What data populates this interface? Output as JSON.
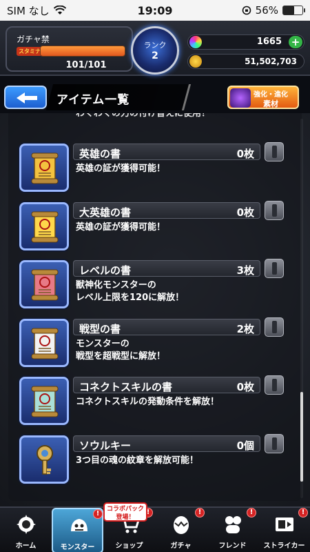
{
  "status_bar": {
    "carrier": "SIM なし",
    "time": "19:09",
    "battery_pct": "56%",
    "battery_level": 0.56
  },
  "header": {
    "gacha_label": "ガチャ禁",
    "stamina_label": "スタミナ",
    "stamina_text": "101/101",
    "stamina_fraction": 1.0,
    "rank_label": "ランク",
    "rank_value": "2",
    "orbs": "1665",
    "coins": "51,502,703"
  },
  "titlebar": {
    "title": "アイテム一覧",
    "evo_line1": "強化・進化",
    "evo_line2": "素材"
  },
  "partial_item": {
    "desc": "わくわくの力の付け替えに使用！"
  },
  "items": [
    {
      "name": "英雄の書",
      "count": "0枚",
      "desc": "英雄の証が獲得可能！",
      "icon": "scroll-red-icon",
      "color": "#f3c23f"
    },
    {
      "name": "大英雄の書",
      "count": "0枚",
      "desc": "英雄の証が獲得可能！",
      "icon": "scroll-gold-icon",
      "color": "#ffd84a"
    },
    {
      "name": "レベルの書",
      "count": "3枚",
      "desc": "獣神化モンスターの\nレベル上限を120に解放！",
      "icon": "scroll-pink-icon",
      "color": "#e77a86"
    },
    {
      "name": "戦型の書",
      "count": "2枚",
      "desc": "モンスターの\n戦型を超戦型に解放！",
      "icon": "scroll-white-icon",
      "color": "#f2f2f2"
    },
    {
      "name": "コネクトスキルの書",
      "count": "0枚",
      "desc": "コネクトスキルの発動条件を解放！",
      "icon": "scroll-teal-icon",
      "color": "#a9e0d8"
    },
    {
      "name": "ソウルキー",
      "count": "0個",
      "desc": "3つ目の魂の紋章を解放可能！",
      "icon": "soul-key-icon",
      "color": "#d8b25a"
    }
  ],
  "scroll": {
    "position": 0.72
  },
  "nav": {
    "collab_tag": "コラボパック\n登場！",
    "items": [
      {
        "label": "ホーム",
        "icon": "home-icon"
      },
      {
        "label": "モンスター",
        "icon": "monster-icon"
      },
      {
        "label": "ショップ",
        "icon": "shop-cart-icon"
      },
      {
        "label": "ガチャ",
        "icon": "gacha-egg-icon"
      },
      {
        "label": "フレンド",
        "icon": "friend-icon"
      },
      {
        "label": "ストライカー",
        "icon": "striker-icon"
      }
    ],
    "badge": "!"
  }
}
